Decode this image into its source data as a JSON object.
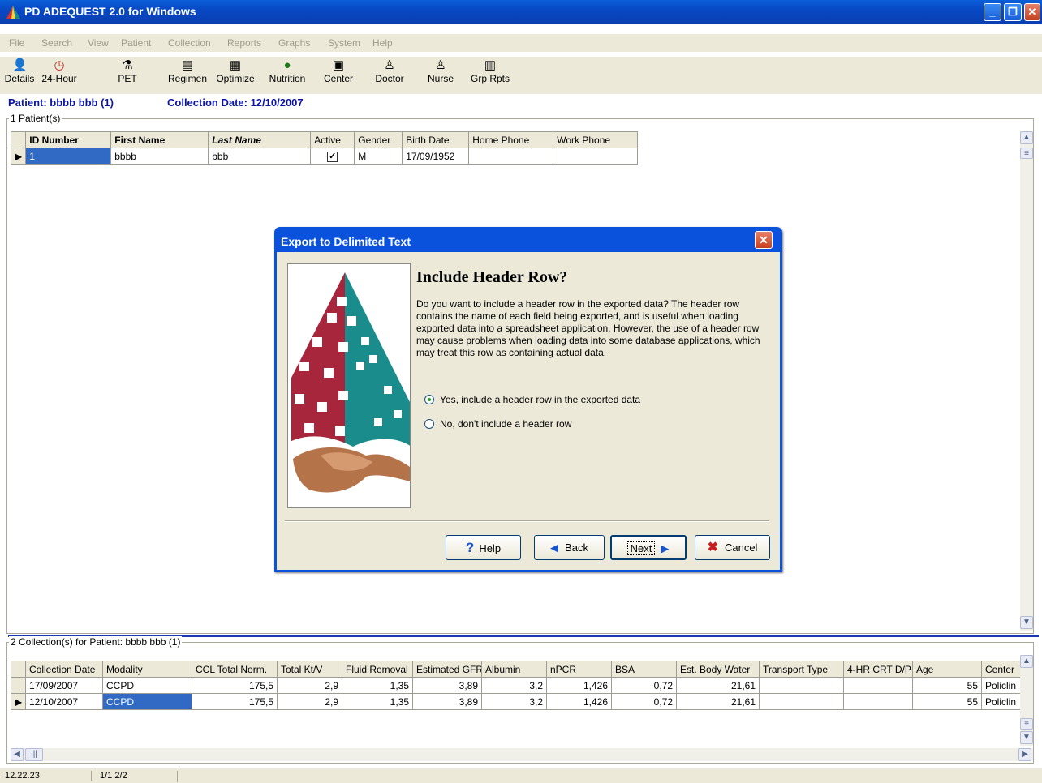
{
  "app": {
    "title": "PD ADEQUEST 2.0 for Windows"
  },
  "menu": [
    "File",
    "Search",
    "View",
    "Patient",
    "Collection",
    "Reports",
    "Graphs",
    "System",
    "Help"
  ],
  "toolbar": [
    {
      "label": "Details",
      "icon": "user-icon"
    },
    {
      "label": "24-Hour",
      "icon": "clock-icon"
    },
    {
      "label": "PET",
      "icon": "flask-icon"
    },
    {
      "label": "Regimen",
      "icon": "regimen-icon"
    },
    {
      "label": "Optimize",
      "icon": "optimize-icon"
    },
    {
      "label": "Nutrition",
      "icon": "apple-icon"
    },
    {
      "label": "Center",
      "icon": "hospital-icon"
    },
    {
      "label": "Doctor",
      "icon": "doctor-icon"
    },
    {
      "label": "Nurse",
      "icon": "nurse-icon"
    },
    {
      "label": "Grp Rpts",
      "icon": "group-reports-icon"
    }
  ],
  "info": {
    "patient": "Patient: bbbb bbb (1)",
    "collection_date": "Collection Date: 12/10/2007"
  },
  "patients": {
    "group_label": "1 Patient(s)",
    "columns": [
      "ID Number",
      "First Name",
      "Last Name",
      "Active",
      "Gender",
      "Birth Date",
      "Home Phone",
      "Work Phone"
    ],
    "rows": [
      {
        "id": "1",
        "first": "bbbb",
        "last": "bbb",
        "active": true,
        "gender": "M",
        "birth": "17/09/1952",
        "home": "",
        "work": ""
      }
    ]
  },
  "dialog": {
    "title": "Export to Delimited Text",
    "heading": "Include Header Row?",
    "body": "Do you want to include a header row in the exported data? The header row contains the name of each field being exported, and is useful when loading exported data into a spreadsheet application. However, the use of a header row may cause problems when loading data into some database applications, which may treat this row as containing actual data.",
    "option_yes": "Yes, include a header row in the exported data",
    "option_no": "No, don't include a header row",
    "selected": "yes",
    "buttons": {
      "help": "Help",
      "back": "Back",
      "next": "Next",
      "cancel": "Cancel"
    }
  },
  "collections": {
    "group_label": "2 Collection(s) for Patient: bbbb bbb (1)",
    "columns": [
      "Collection Date",
      "Modality",
      "CCL Total Norm.",
      "Total Kt/V",
      "Fluid Removal",
      "Estimated GFR",
      "Albumin",
      "nPCR",
      "BSA",
      "Est. Body Water",
      "Transport Type",
      "4-HR CRT D/P",
      "Age",
      "Center"
    ],
    "rows": [
      [
        "17/09/2007",
        "CCPD",
        "175,5",
        "2,9",
        "1,35",
        "3,89",
        "3,2",
        "1,426",
        "0,72",
        "21,61",
        "",
        "",
        "55",
        "Policlin"
      ],
      [
        "12/10/2007",
        "CCPD",
        "175,5",
        "2,9",
        "1,35",
        "3,89",
        "3,2",
        "1,426",
        "0,72",
        "21,61",
        "",
        "",
        "55",
        "Policlin"
      ]
    ]
  },
  "status": {
    "time": "12.22.23",
    "pages": "1/1  2/2"
  },
  "colors": {
    "title_blue": "#0a51dc",
    "info_blue": "#0b14a8",
    "face": "#ece9d8",
    "select": "#316ac5"
  }
}
